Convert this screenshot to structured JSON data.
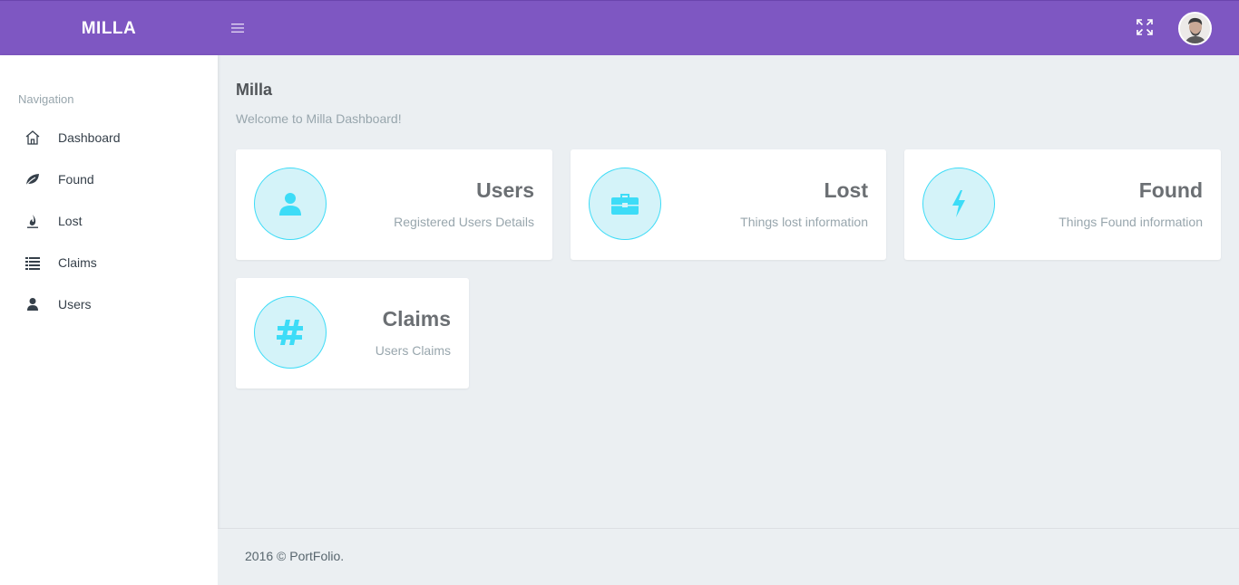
{
  "brand": {
    "title": "MILLA"
  },
  "header": {
    "menu_icon": "hamburger-icon",
    "fullscreen_icon": "fullscreen-icon",
    "avatar_icon": "user-avatar"
  },
  "sidebar": {
    "heading": "Navigation",
    "items": [
      {
        "label": "Dashboard",
        "icon": "home-icon"
      },
      {
        "label": "Found",
        "icon": "leaf-icon"
      },
      {
        "label": "Lost",
        "icon": "fire-icon"
      },
      {
        "label": "Claims",
        "icon": "list-icon"
      },
      {
        "label": "Users",
        "icon": "user-icon"
      }
    ]
  },
  "main": {
    "title": "Milla",
    "subtitle": "Welcome to Milla Dashboard!",
    "cards": [
      {
        "title": "Users",
        "description": "Registered Users Details",
        "icon": "user-icon"
      },
      {
        "title": "Lost",
        "description": "Things lost information",
        "icon": "briefcase-icon"
      },
      {
        "title": "Found",
        "description": "Things Found information",
        "icon": "bolt-icon"
      },
      {
        "title": "Claims",
        "description": "Users Claims",
        "icon": "hash-icon"
      }
    ]
  },
  "footer": {
    "text": "2016 © PortFolio."
  },
  "colors": {
    "topbar": "#7e57c2",
    "accent": "#3ddcf7",
    "accent_light": "#d4f3f9",
    "background": "#ebeff2"
  }
}
